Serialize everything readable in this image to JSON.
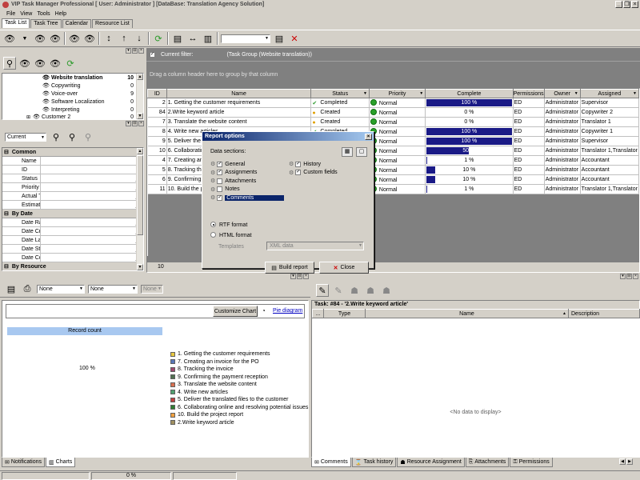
{
  "window": {
    "title": "VIP Task Manager Professional [ User: Administrator ] [DataBase: Translation Agency Solution]"
  },
  "menu": [
    "File",
    "View",
    "Tools",
    "Help"
  ],
  "tabs": [
    "Task List",
    "Task Tree",
    "Calendar",
    "Resource List"
  ],
  "tree": {
    "items": [
      {
        "label": "Website translation",
        "count": "10",
        "bold": true,
        "level": 1
      },
      {
        "label": "Copywriting",
        "count": "0",
        "level": 2
      },
      {
        "label": "Voice-over",
        "count": "9",
        "level": 2
      },
      {
        "label": "Software Localization",
        "count": "0",
        "level": 2
      },
      {
        "label": "Interpreting",
        "count": "0",
        "level": 2
      },
      {
        "label": "Customer 2",
        "count": "0",
        "level": 1
      }
    ]
  },
  "filter_combo": "Current",
  "properties": [
    {
      "category": "Common",
      "items": [
        "Name",
        "ID",
        "Status",
        "Priority",
        "Actual Tim",
        "Estimated"
      ]
    },
    {
      "category": "By Date",
      "items": [
        "Date Rang",
        "Date Creat",
        "Date Last I",
        "Date Startı",
        "Date Comp"
      ]
    },
    {
      "category": "By Resource",
      "items": []
    }
  ],
  "grid": {
    "filter_label": "Current filter:",
    "filter_value": "(Task Group  (Website translation))",
    "group_hint": "Drag a column header here to group by that column",
    "columns": [
      "ID",
      "Name",
      "Status",
      "Priority",
      "Complete",
      "Permissions",
      "Owner",
      "Assigned"
    ],
    "rows": [
      {
        "id": "2",
        "name": "1. Getting the customer requirements",
        "status": "Completed",
        "priority": "Normal",
        "complete": 100,
        "complete_label": "100 %",
        "perm": "ED",
        "owner": "Administrator",
        "assigned": "Supervisor"
      },
      {
        "id": "84",
        "name": "2.Write keyword article",
        "status": "Created",
        "priority": "Normal",
        "complete": 0,
        "complete_label": "0 %",
        "perm": "ED",
        "owner": "Administrator",
        "assigned": "Copywriter 2"
      },
      {
        "id": "7",
        "name": "3. Translate the website content",
        "status": "Created",
        "priority": "Normal",
        "complete": 0,
        "complete_label": "0 %",
        "perm": "ED",
        "owner": "Administrator",
        "assigned": "Translator 1"
      },
      {
        "id": "8",
        "name": "4. Write new articles",
        "status": "Completed",
        "priority": "Normal",
        "complete": 100,
        "complete_label": "100 %",
        "perm": "ED",
        "owner": "Administrator",
        "assigned": "Copywriter 1"
      },
      {
        "id": "9",
        "name": "5. Deliver the t",
        "status": "",
        "priority": "Normal",
        "complete": 100,
        "complete_label": "100 %",
        "perm": "ED",
        "owner": "Administrator",
        "assigned": "Supervisor"
      },
      {
        "id": "10",
        "name": "6. Collaboratin",
        "status": "",
        "priority": "Normal",
        "complete": 50,
        "complete_label": "50 %",
        "perm": "ED",
        "owner": "Administrator",
        "assigned": "Translator 1,Translator"
      },
      {
        "id": "4",
        "name": "7. Creating an",
        "status": "",
        "priority": "Normal",
        "complete": 1,
        "complete_label": "1 %",
        "perm": "ED",
        "owner": "Administrator",
        "assigned": "Accountant"
      },
      {
        "id": "5",
        "name": "8. Tracking the",
        "status": "",
        "priority": "Normal",
        "complete": 10,
        "complete_label": "10 %",
        "perm": "ED",
        "owner": "Administrator",
        "assigned": "Accountant"
      },
      {
        "id": "6",
        "name": "9. Confirming t",
        "status": "",
        "priority": "Normal",
        "complete": 10,
        "complete_label": "10 %",
        "perm": "ED",
        "owner": "Administrator",
        "assigned": "Accountant"
      },
      {
        "id": "11",
        "name": "10. Build the pr",
        "status": "",
        "priority": "Normal",
        "complete": 1,
        "complete_label": "1 %",
        "perm": "ED",
        "owner": "Administrator",
        "assigned": "Translator 1,Translator"
      }
    ],
    "footer_count": "10"
  },
  "dialog": {
    "title": "Report options",
    "sections_label": "Data sections:",
    "sections_left": [
      {
        "label": "General",
        "checked": true
      },
      {
        "label": "Assignments",
        "checked": true
      },
      {
        "label": "Attachments",
        "checked": false
      },
      {
        "label": "Notes",
        "checked": false
      },
      {
        "label": "Comments",
        "checked": true,
        "selected": true
      }
    ],
    "sections_right": [
      {
        "label": "History",
        "checked": true
      },
      {
        "label": "Custom fields",
        "checked": true
      }
    ],
    "rtf": "RTF format",
    "html": "HTML format",
    "templates_label": "Templates",
    "templates_value": "XML data",
    "build": "Build report",
    "close": "Close"
  },
  "chart": {
    "combo1": "None",
    "combo2": "None",
    "combo3": "None",
    "customize": "Customize Chart",
    "pie_link": "Pie diagram",
    "header": "Record count",
    "percent": "100 %"
  },
  "chart_data": {
    "type": "pie",
    "title": "Record count",
    "values": [
      100
    ],
    "labels": [
      "100 %"
    ],
    "legend": [
      {
        "label": "1. Getting the customer requirements",
        "color": "#e8c840"
      },
      {
        "label": "7. Creating an invoice for the PO",
        "color": "#5878b8"
      },
      {
        "label": "8. Tracking the invoice",
        "color": "#a04870"
      },
      {
        "label": "9. Confirming the payment reception",
        "color": "#507050"
      },
      {
        "label": "3. Translate the website content",
        "color": "#d87050"
      },
      {
        "label": "4. Write new articles",
        "color": "#50a070"
      },
      {
        "label": "5. Deliver the translated files to the customer",
        "color": "#c04040"
      },
      {
        "label": "6. Collaborating online and resolving potential issues",
        "color": "#2e7d32"
      },
      {
        "label": "10. Build the project report",
        "color": "#f0a040"
      },
      {
        "label": "2.Write keyword article",
        "color": "#a09060"
      }
    ]
  },
  "attachments": {
    "task_title": "Task: #84 - '2.Write keyword article'",
    "columns": [
      "...",
      "Type",
      "Name",
      "Description"
    ],
    "empty": "<No data to display>"
  },
  "bottom_tabs_left": [
    "Notifications",
    "Charts"
  ],
  "bottom_tabs_right": [
    "Comments",
    "Task history",
    "Resource Assignment",
    "Attachments",
    "Permissions"
  ],
  "statusbar": {
    "progress": "0 %"
  }
}
